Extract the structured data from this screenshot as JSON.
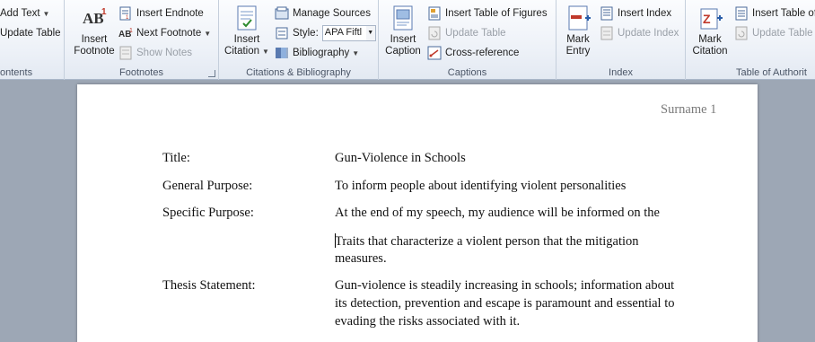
{
  "ribbon": {
    "research": {
      "add_text": "Add Text",
      "update_table": "Update Table",
      "label": "ontents"
    },
    "footnotes": {
      "insert_footnote": [
        "Insert",
        "Footnote"
      ],
      "insert_endnote": "Insert Endnote",
      "next_footnote": "Next Footnote",
      "show_notes": "Show Notes",
      "label": "Footnotes"
    },
    "citations": {
      "insert_citation": [
        "Insert",
        "Citation"
      ],
      "manage_sources": "Manage Sources",
      "style_label": "Style:",
      "style_value": "APA Fiftl",
      "bibliography": "Bibliography",
      "label": "Citations & Bibliography"
    },
    "captions": {
      "insert_caption": [
        "Insert",
        "Caption"
      ],
      "insert_table_of_figures": "Insert Table of Figures",
      "update_table": "Update Table",
      "cross_reference": "Cross-reference",
      "label": "Captions"
    },
    "index": {
      "mark_entry": [
        "Mark",
        "Entry"
      ],
      "insert_index": "Insert Index",
      "update_index": "Update Index",
      "label": "Index"
    },
    "authorities": {
      "mark_citation": [
        "Mark",
        "Citation"
      ],
      "insert_table_of": "Insert Table of",
      "update_table": "Update Table",
      "label": "Table of Authorit"
    }
  },
  "document": {
    "header": "Surname 1",
    "rows": [
      {
        "label": "Title:",
        "lines": [
          "Gun-Violence in Schools"
        ]
      },
      {
        "label": "General Purpose:",
        "lines": [
          "To inform people about identifying violent personalities"
        ]
      },
      {
        "label": "Specific Purpose:",
        "lines": [
          "At the end of my speech, my audience will be informed on the"
        ]
      },
      {
        "label": "",
        "lines": [
          "Traits that characterize a violent person that the mitigation",
          "measures."
        ]
      },
      {
        "label": "Thesis Statement:",
        "lines": [
          "Gun-violence is steadily increasing in schools; information about",
          "its detection, prevention and escape is paramount and essential to",
          "evading the risks associated with it."
        ]
      }
    ]
  },
  "colors": {
    "ribbon_bg": "#eef2f8",
    "doc_background": "#9da7b5",
    "accent_blue": "#2a5ea8",
    "accent_red": "#c0392b"
  }
}
